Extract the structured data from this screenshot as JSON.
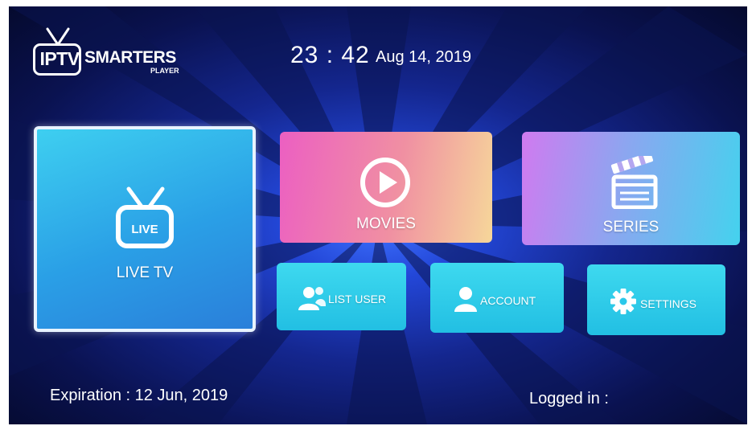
{
  "logo": {
    "iptv": "IPTV",
    "smarters": "SMARTERS",
    "player": "PLAYER"
  },
  "header": {
    "time": "23 : 42",
    "date": "Aug 14, 2019"
  },
  "tiles": {
    "live": {
      "badge": "LIVE",
      "label": "LIVE TV"
    },
    "movies": {
      "label": "MOVIES"
    },
    "series": {
      "label": "SERIES"
    },
    "list_user": {
      "label": "LIST USER"
    },
    "account": {
      "label": "ACCOUNT"
    },
    "settings": {
      "label": "SETTINGS"
    }
  },
  "footer": {
    "expiration": "Expiration : 12 Jun, 2019",
    "logged_in": "Logged in :"
  },
  "icons": [
    "tv-antenna-icon",
    "play-icon",
    "clapperboard-icon",
    "users-icon",
    "user-icon",
    "gear-icon"
  ],
  "colors": {
    "live_tile": "#2a9fe6",
    "movies_start": "#ec5fc2",
    "movies_end": "#f6d79a",
    "series_start": "#d07af0",
    "series_end": "#44d2ee",
    "small_tile": "#2bc8ea",
    "background": "#14268e"
  }
}
